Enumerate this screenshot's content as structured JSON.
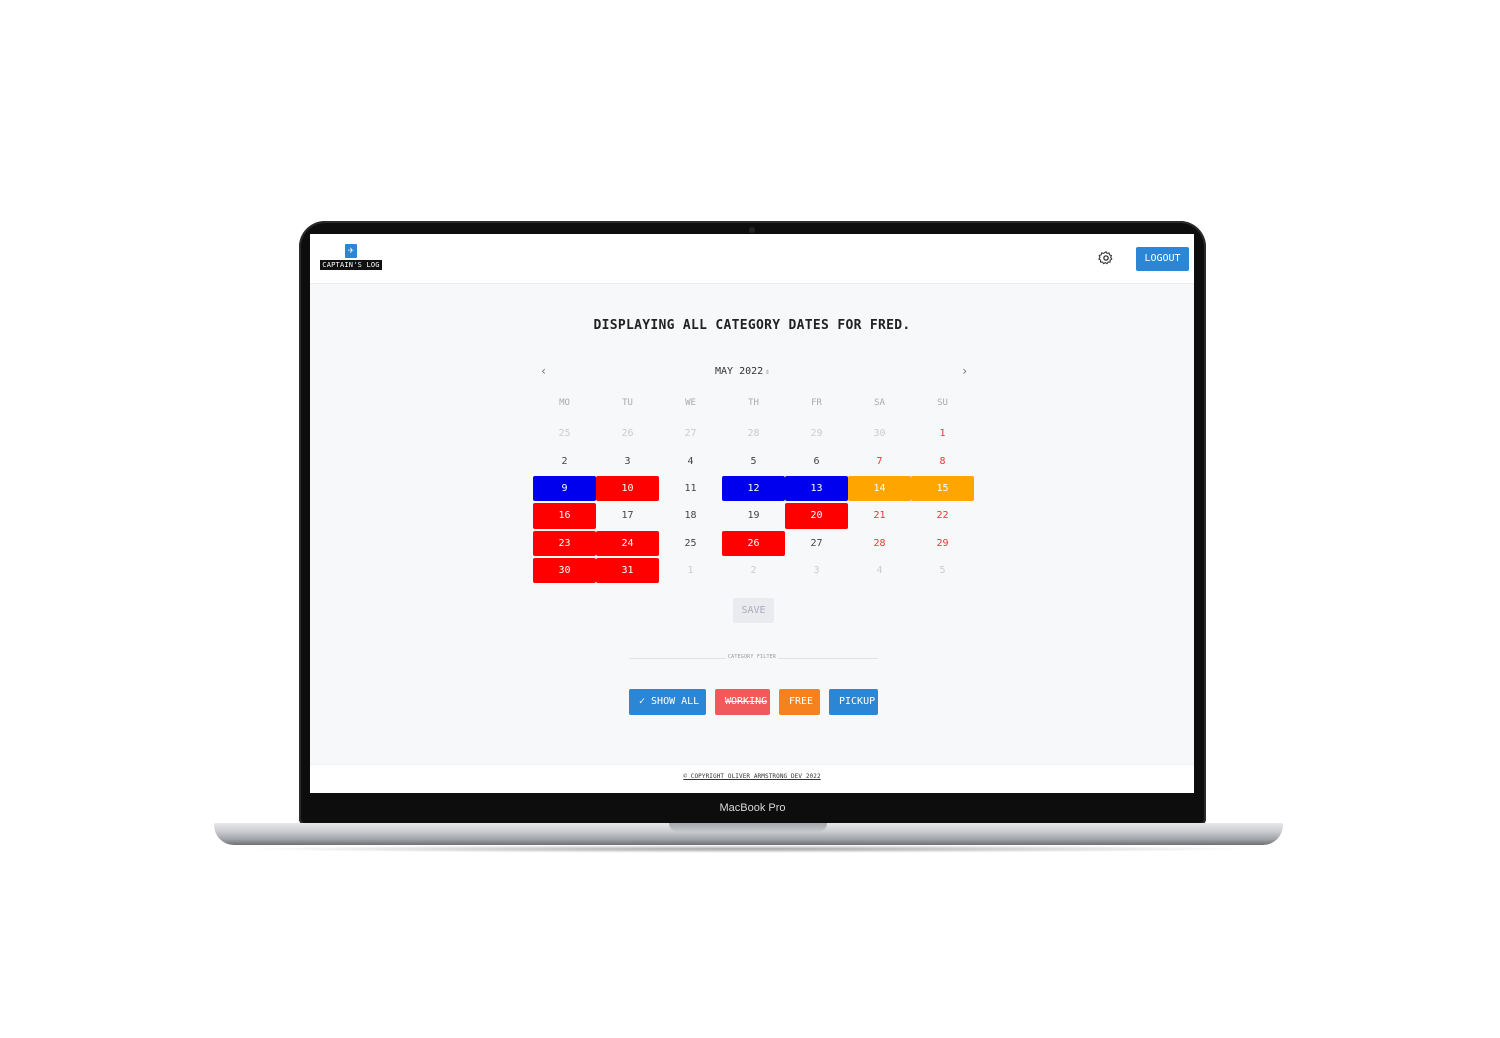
{
  "device": {
    "model_label": "MacBook Pro"
  },
  "header": {
    "logo_text": "CAPTAIN'S LOG",
    "logout_label": "LOGOUT"
  },
  "page": {
    "title": "DISPLAYING ALL CATEGORY DATES FOR FRED."
  },
  "calendar": {
    "prev_label": "‹",
    "next_label": "›",
    "month_label": "MAY 2022",
    "weekdays": [
      "MO",
      "TU",
      "WE",
      "TH",
      "FR",
      "SA",
      "SU"
    ],
    "days": [
      {
        "label": "25",
        "muted": true
      },
      {
        "label": "26",
        "muted": true
      },
      {
        "label": "27",
        "muted": true
      },
      {
        "label": "28",
        "muted": true
      },
      {
        "label": "29",
        "muted": true
      },
      {
        "label": "30",
        "muted": true
      },
      {
        "label": "1",
        "weekend": true
      },
      {
        "label": "2"
      },
      {
        "label": "3"
      },
      {
        "label": "4"
      },
      {
        "label": "5"
      },
      {
        "label": "6"
      },
      {
        "label": "7",
        "weekend": true
      },
      {
        "label": "8",
        "weekend": true
      },
      {
        "label": "9",
        "category": "blue"
      },
      {
        "label": "10",
        "category": "red"
      },
      {
        "label": "11"
      },
      {
        "label": "12",
        "category": "blue"
      },
      {
        "label": "13",
        "category": "blue"
      },
      {
        "label": "14",
        "category": "orange"
      },
      {
        "label": "15",
        "category": "orange"
      },
      {
        "label": "16",
        "category": "red"
      },
      {
        "label": "17"
      },
      {
        "label": "18"
      },
      {
        "label": "19"
      },
      {
        "label": "20",
        "category": "red"
      },
      {
        "label": "21",
        "weekend": true
      },
      {
        "label": "22",
        "weekend": true
      },
      {
        "label": "23",
        "category": "red"
      },
      {
        "label": "24",
        "category": "red"
      },
      {
        "label": "25"
      },
      {
        "label": "26",
        "category": "red"
      },
      {
        "label": "27"
      },
      {
        "label": "28",
        "weekend": true
      },
      {
        "label": "29",
        "weekend": true
      },
      {
        "label": "30",
        "category": "red"
      },
      {
        "label": "31",
        "category": "red"
      },
      {
        "label": "1",
        "muted": true
      },
      {
        "label": "2",
        "muted": true
      },
      {
        "label": "3",
        "muted": true
      },
      {
        "label": "4",
        "muted": true
      },
      {
        "label": "5",
        "muted": true
      }
    ],
    "save_label": "SAVE"
  },
  "filter": {
    "divider_label": "CATEGORY FILTER",
    "show_all_label": "✓ SHOW ALL",
    "working_label": "WORKING",
    "free_label": "FREE",
    "pickup_label": "PICKUP"
  },
  "footer": {
    "text": "© COPYRIGHT OLIVER ARMSTRONG DEV 2022"
  },
  "colors": {
    "accent": "#2b86d6",
    "category_blue": "#0000ee",
    "category_red": "#ff0000",
    "category_orange": "#ffa500",
    "working": "#f05a5a",
    "free": "#f5821f"
  }
}
